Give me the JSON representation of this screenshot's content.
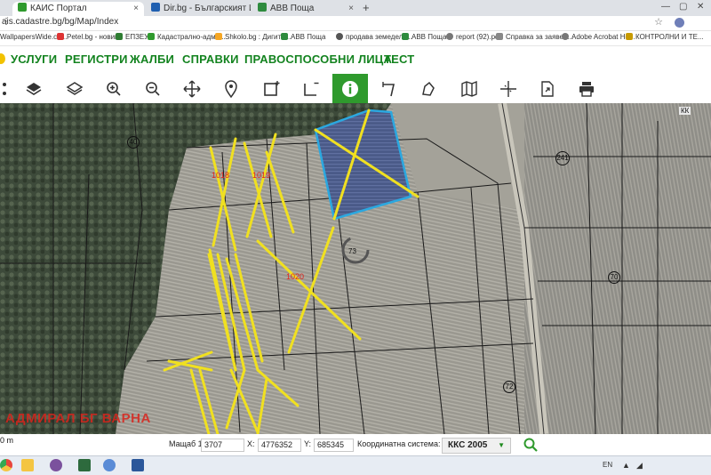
{
  "browser": {
    "tabs": [
      {
        "title": "КАИС Портал",
        "active": true,
        "color": "#2f9a2d"
      },
      {
        "title": "Dir.bg - Българският Интернет",
        "active": false,
        "color": "#1f5fb0"
      },
      {
        "title": "АВВ Поща",
        "active": false,
        "color": "#2e8b3e"
      }
    ],
    "tab_close": "×",
    "new_tab": "+",
    "window_controls": [
      "—",
      "▢",
      "✕"
    ],
    "url": "ais.cadastre.bg/bg/Map/Index",
    "bookmarks": [
      {
        "label": "WallpapersWide.co...",
        "color": "#3a7bd5"
      },
      {
        "label": "Petel.bg - новини",
        "color": "#d33"
      },
      {
        "label": "ЕПЗЕУ",
        "color": "#2e7d32"
      },
      {
        "label": "Кадастрално-адми...",
        "color": "#2f9a2d"
      },
      {
        "label": "Shkolo.bg : Дигита...",
        "color": "#f5a623"
      },
      {
        "label": "АВВ Поща",
        "color": "#2e8b3e"
      },
      {
        "label": "продава земеделс...",
        "color": "#555"
      },
      {
        "label": "АВВ Поща",
        "color": "#2e8b3e"
      },
      {
        "label": "report (92).pdf",
        "color": "#777"
      },
      {
        "label": "Справка за заявен...",
        "color": "#888"
      },
      {
        "label": "Adobe Acrobat Ho...",
        "color": "#777"
      },
      {
        "label": "КОНТРОЛНИ И ТЕ...",
        "color": "#c79a00"
      }
    ]
  },
  "nav": {
    "items": [
      "УСЛУГИ",
      "РЕГИСТРИ",
      "ЖАЛБИ",
      "СПРАВКИ",
      "ПРАВОСПОСОБНИ ЛИЦА",
      "ТЕСТ"
    ],
    "color": "#13831f"
  },
  "toolbar": {
    "tools": [
      {
        "icon": "layers-share-icon"
      },
      {
        "icon": "layers-icon"
      },
      {
        "icon": "layers-outline-icon"
      },
      {
        "icon": "zoom-in-icon"
      },
      {
        "icon": "zoom-out-icon"
      },
      {
        "icon": "pan-icon"
      },
      {
        "icon": "location-pin-icon"
      },
      {
        "icon": "draw-rectangle-icon"
      },
      {
        "icon": "draw-line-rectangle-icon"
      },
      {
        "icon": "info-icon",
        "active": true
      },
      {
        "icon": "measure-distance-icon"
      },
      {
        "icon": "measure-area-icon"
      },
      {
        "icon": "map-icon"
      },
      {
        "icon": "coordinates-icon"
      },
      {
        "icon": "export-icon"
      },
      {
        "icon": "print-icon"
      }
    ],
    "active_color": "#2f9a2d"
  },
  "map": {
    "parcel_numbers": [
      "40",
      "241",
      "73",
      "70",
      "72"
    ],
    "red_labels": [
      "1018",
      "1019",
      "1020"
    ],
    "watermark": "АДМИРАЛ БГ ВАРНА",
    "corner_label": "КК",
    "highlight_color": "#2ba8e0",
    "annotation_color": "#f0e020"
  },
  "coords": {
    "scale_bar": "0 m",
    "scale_label": "Мащаб 1:",
    "scale_value": "3707",
    "x_label": "X:",
    "x_value": "4776352",
    "y_label": "Y:",
    "y_value": "685345",
    "system_label": "Координатна система:",
    "system_value": "ККС 2005",
    "dropdown_arrow": "▼"
  },
  "taskbar": {
    "apps": [
      {
        "icon": "chrome-icon",
        "color": "#e8453c"
      },
      {
        "icon": "file-explorer-icon",
        "color": "#f4c542"
      },
      {
        "icon": "viber-icon",
        "color": "#7b519d"
      },
      {
        "icon": "app-icon",
        "color": "#2d6a3d"
      },
      {
        "icon": "network-icon",
        "color": "#5a8bd6"
      },
      {
        "icon": "word-icon",
        "color": "#2b579a"
      }
    ],
    "tray_lang": "EN"
  }
}
